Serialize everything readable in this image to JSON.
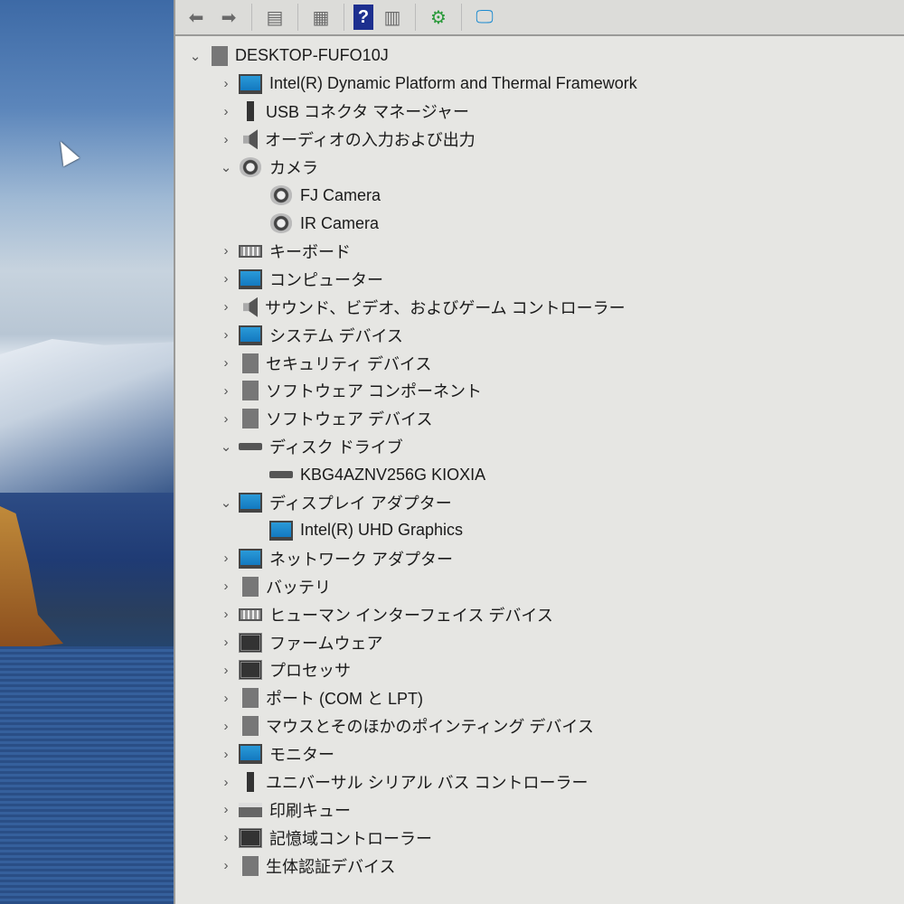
{
  "toolbar": {
    "buttons": [
      "back",
      "forward",
      "show-hide-console-tree",
      "properties",
      "help",
      "show-hide-action-pane",
      "update-driver",
      "scan-hardware"
    ]
  },
  "tree": {
    "root": "DESKTOP-FUFO10J",
    "items": [
      {
        "label": "Intel(R) Dynamic Platform and Thermal Framework",
        "icon": "mon",
        "expanded": false,
        "level": 1
      },
      {
        "label": "USB コネクタ マネージャー",
        "icon": "usb",
        "expanded": false,
        "level": 1
      },
      {
        "label": "オーディオの入力および出力",
        "icon": "spk",
        "expanded": false,
        "level": 1
      },
      {
        "label": "カメラ",
        "icon": "cam",
        "expanded": true,
        "level": 1
      },
      {
        "label": "FJ Camera",
        "icon": "cam",
        "level": 2
      },
      {
        "label": "IR Camera",
        "icon": "cam",
        "level": 2
      },
      {
        "label": "キーボード",
        "icon": "kb",
        "expanded": false,
        "level": 1
      },
      {
        "label": "コンピューター",
        "icon": "mon",
        "expanded": false,
        "level": 1
      },
      {
        "label": "サウンド、ビデオ、およびゲーム コントローラー",
        "icon": "spk",
        "expanded": false,
        "level": 1
      },
      {
        "label": "システム デバイス",
        "icon": "mon",
        "expanded": false,
        "level": 1
      },
      {
        "label": "セキュリティ デバイス",
        "icon": "gray",
        "expanded": false,
        "level": 1
      },
      {
        "label": "ソフトウェア コンポーネント",
        "icon": "gray",
        "expanded": false,
        "level": 1
      },
      {
        "label": "ソフトウェア デバイス",
        "icon": "gray",
        "expanded": false,
        "level": 1
      },
      {
        "label": "ディスク ドライブ",
        "icon": "disk",
        "expanded": true,
        "level": 1
      },
      {
        "label": "KBG4AZNV256G KIOXIA",
        "icon": "disk",
        "level": 2
      },
      {
        "label": "ディスプレイ アダプター",
        "icon": "mon",
        "expanded": true,
        "level": 1
      },
      {
        "label": "Intel(R) UHD Graphics",
        "icon": "mon",
        "level": 2
      },
      {
        "label": "ネットワーク アダプター",
        "icon": "mon",
        "expanded": false,
        "level": 1
      },
      {
        "label": "バッテリ",
        "icon": "gray",
        "expanded": false,
        "level": 1
      },
      {
        "label": "ヒューマン インターフェイス デバイス",
        "icon": "kb",
        "expanded": false,
        "level": 1
      },
      {
        "label": "ファームウェア",
        "icon": "chip",
        "expanded": false,
        "level": 1
      },
      {
        "label": "プロセッサ",
        "icon": "chip",
        "expanded": false,
        "level": 1
      },
      {
        "label": "ポート (COM と LPT)",
        "icon": "gray",
        "expanded": false,
        "level": 1
      },
      {
        "label": "マウスとそのほかのポインティング デバイス",
        "icon": "gray",
        "expanded": false,
        "level": 1
      },
      {
        "label": "モニター",
        "icon": "mon",
        "expanded": false,
        "level": 1
      },
      {
        "label": "ユニバーサル シリアル バス コントローラー",
        "icon": "usb",
        "expanded": false,
        "level": 1
      },
      {
        "label": "印刷キュー",
        "icon": "prn",
        "expanded": false,
        "level": 1
      },
      {
        "label": "記憶域コントローラー",
        "icon": "chip",
        "expanded": false,
        "level": 1
      },
      {
        "label": "生体認証デバイス",
        "icon": "gray",
        "expanded": false,
        "level": 1
      }
    ]
  }
}
